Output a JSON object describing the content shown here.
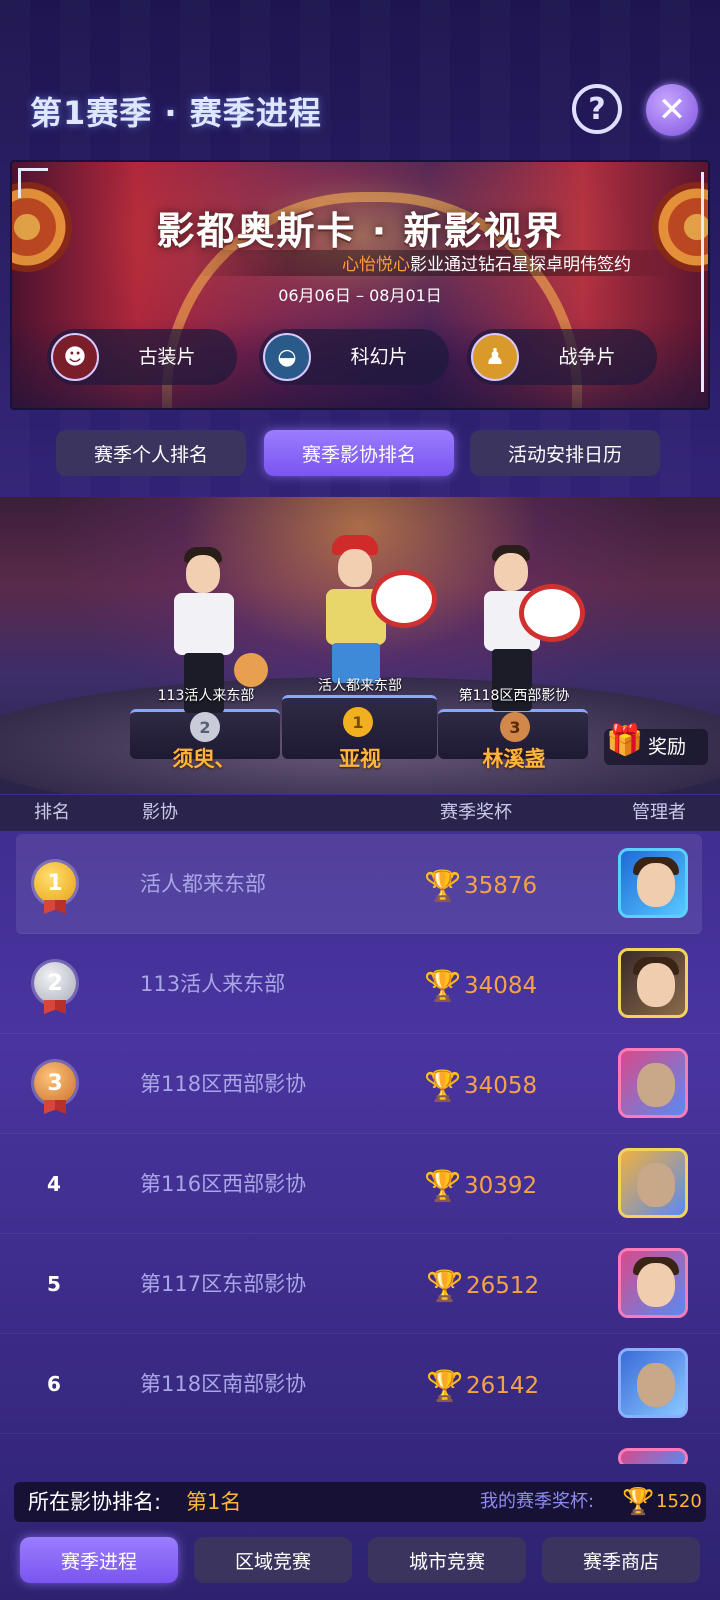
{
  "header": {
    "title": "第1赛季 · 赛季进程",
    "help_label": "?",
    "close_label": "✕"
  },
  "banner": {
    "title": "影都奥斯卡 · 新影视界",
    "ticker_highlight": "心怡悦心",
    "ticker_text": "影业通过钻石星探卓明伟签约",
    "dates": "06月06日 – 08月01日",
    "genres": [
      {
        "label": "古装片",
        "icon": "opera-mask-icon"
      },
      {
        "label": "科幻片",
        "icon": "ufo-icon"
      },
      {
        "label": "战争片",
        "icon": "soldier-icon"
      }
    ]
  },
  "tabs": [
    {
      "label": "赛季个人排名",
      "active": false
    },
    {
      "label": "赛季影协排名",
      "active": true
    },
    {
      "label": "活动安排日历",
      "active": false
    }
  ],
  "podium": {
    "left": {
      "guild": "113活人来东部",
      "rank": "2",
      "player": "须臾、"
    },
    "center": {
      "guild": "活人都来东部",
      "rank": "1",
      "player": "亚视"
    },
    "right": {
      "guild": "第118区西部影协",
      "rank": "3",
      "player": "林溪盏"
    },
    "reward_label": "奖励"
  },
  "table": {
    "columns": [
      "排名",
      "影协",
      "赛季奖杯",
      "管理者"
    ],
    "rows": [
      {
        "rank": "1",
        "medal": "gold",
        "guild": "活人都来东部",
        "trophies": "35876"
      },
      {
        "rank": "2",
        "medal": "silver",
        "guild": "113活人来东部",
        "trophies": "34084"
      },
      {
        "rank": "3",
        "medal": "bronze",
        "guild": "第118区西部影协",
        "trophies": "34058"
      },
      {
        "rank": "4",
        "medal": "",
        "guild": "第116区西部影协",
        "trophies": "30392"
      },
      {
        "rank": "5",
        "medal": "",
        "guild": "第117区东部影协",
        "trophies": "26512"
      },
      {
        "rank": "6",
        "medal": "",
        "guild": "第118区南部影协",
        "trophies": "26142"
      }
    ]
  },
  "footer_info": {
    "guild_rank_label": "所在影协排名:",
    "guild_rank_value": "第1名",
    "my_trophies_label": "我的赛季奖杯:",
    "my_trophies_value": "1520"
  },
  "bottom_nav": [
    {
      "label": "赛季进程",
      "active": true
    },
    {
      "label": "区域竞赛",
      "active": false
    },
    {
      "label": "城市竞赛",
      "active": false
    },
    {
      "label": "赛季商店",
      "active": false
    }
  ],
  "colors": {
    "accent_purple": "#8b68f7",
    "gold_text": "#ffb53a",
    "guild_text": "#a9a6e6"
  }
}
